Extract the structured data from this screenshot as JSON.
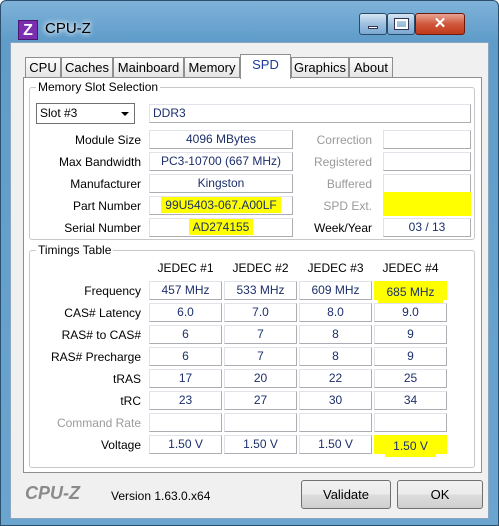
{
  "window": {
    "title": "CPU-Z",
    "icon_letter": "Z",
    "close_glyph": "✕"
  },
  "tabs": [
    "CPU",
    "Caches",
    "Mainboard",
    "Memory",
    "SPD",
    "Graphics",
    "About"
  ],
  "active_tab": "SPD",
  "slot_section": {
    "legend": "Memory Slot Selection",
    "slot_select": "Slot #3",
    "memory_type": "DDR3",
    "rows": {
      "module_size": {
        "label": "Module Size",
        "value": "4096 MBytes"
      },
      "max_bandwidth": {
        "label": "Max Bandwidth",
        "value": "PC3-10700 (667 MHz)"
      },
      "manufacturer": {
        "label": "Manufacturer",
        "value": "Kingston"
      },
      "part_number": {
        "label": "Part Number",
        "value": "99U5403-067.A00LF"
      },
      "serial_number": {
        "label": "Serial Number",
        "value": "AD274155"
      }
    },
    "right_rows": {
      "correction": {
        "label": "Correction",
        "value": ""
      },
      "registered": {
        "label": "Registered",
        "value": ""
      },
      "buffered": {
        "label": "Buffered",
        "value": ""
      },
      "spd_ext": {
        "label": "SPD Ext.",
        "value": ""
      },
      "week_year": {
        "label": "Week/Year",
        "value": "03 / 13"
      }
    }
  },
  "timings": {
    "legend": "Timings Table",
    "columns": [
      "JEDEC #1",
      "JEDEC #2",
      "JEDEC #3",
      "JEDEC #4"
    ],
    "rows": [
      {
        "label": "Frequency",
        "values": [
          "457 MHz",
          "533 MHz",
          "609 MHz",
          "685 MHz"
        ]
      },
      {
        "label": "CAS# Latency",
        "values": [
          "6.0",
          "7.0",
          "8.0",
          "9.0"
        ]
      },
      {
        "label": "RAS# to CAS#",
        "values": [
          "6",
          "7",
          "8",
          "9"
        ]
      },
      {
        "label": "RAS# Precharge",
        "values": [
          "6",
          "7",
          "8",
          "9"
        ]
      },
      {
        "label": "tRAS",
        "values": [
          "17",
          "20",
          "22",
          "25"
        ]
      },
      {
        "label": "tRC",
        "values": [
          "23",
          "27",
          "30",
          "34"
        ]
      },
      {
        "label": "Command Rate",
        "values": [
          "",
          "",
          "",
          ""
        ]
      },
      {
        "label": "Voltage",
        "values": [
          "1.50 V",
          "1.50 V",
          "1.50 V",
          "1.50 V"
        ]
      }
    ]
  },
  "footer": {
    "logo": "CPU-Z",
    "version": "Version 1.63.0.x64",
    "validate_label": "Validate",
    "ok_label": "OK"
  },
  "colors": {
    "highlight": "#ffff00",
    "value_text": "#1c2f6b",
    "window_frame": "#6aa5d0"
  }
}
